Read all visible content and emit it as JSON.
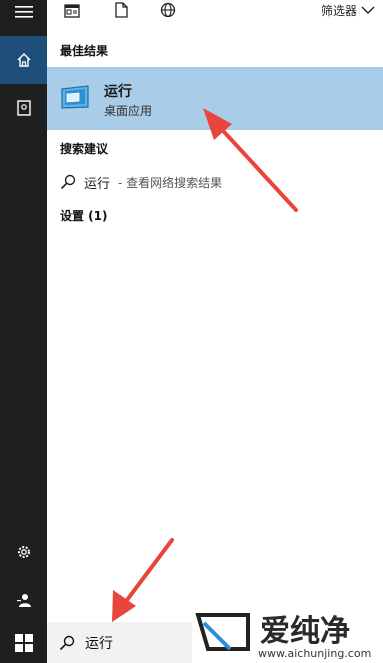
{
  "top": {
    "filter_label": "筛选器"
  },
  "sections": {
    "best_match": "最佳结果",
    "search_suggestions": "搜索建议",
    "settings": "设置 (1)"
  },
  "best_result": {
    "title": "运行",
    "subtitle": "桌面应用"
  },
  "suggestion": {
    "query": "运行",
    "hint": "- 查看网络搜索结果"
  },
  "search": {
    "value": "运行"
  },
  "watermark": {
    "brand": "爱纯净",
    "url": "www.aichunjing.com"
  },
  "colors": {
    "sidebar": "#1f1f1f",
    "active_sidebar": "#1e4f7a",
    "best_highlight": "#a9cce9",
    "arrow": "#e8453c"
  },
  "icons": [
    "hamburger-icon",
    "home-icon",
    "notebook-icon",
    "document-icon",
    "file-icon",
    "globe-icon",
    "chevron-down-icon",
    "run-app-icon",
    "search-icon",
    "gear-icon",
    "user-icon",
    "windows-logo-icon"
  ]
}
